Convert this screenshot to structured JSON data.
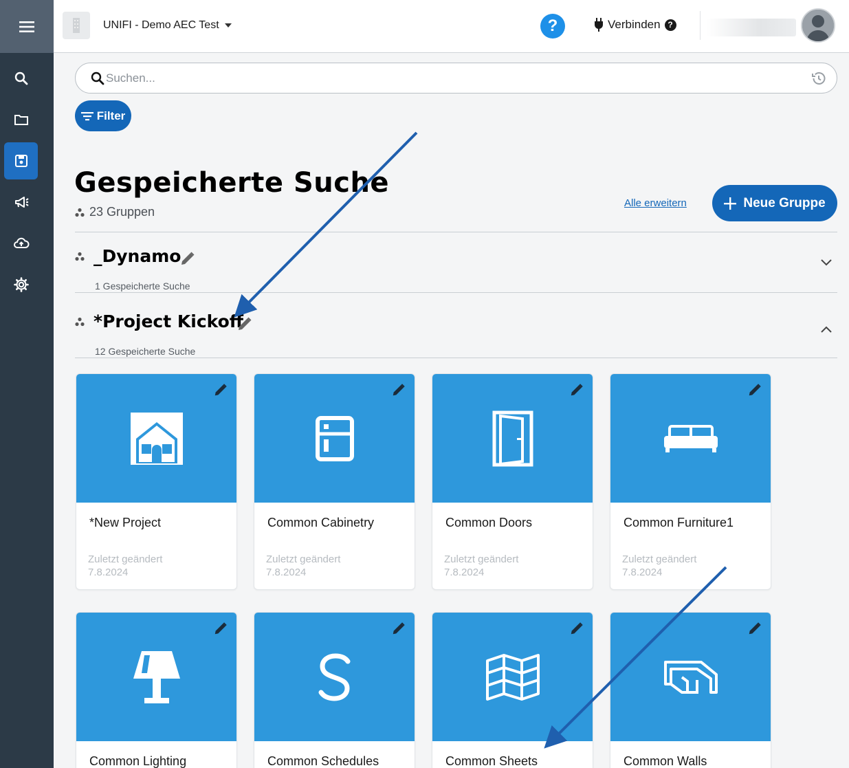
{
  "header": {
    "project_name": "UNIFI - Demo AEC Test",
    "help_label": "?",
    "connect_label": "Verbinden",
    "connect_help": "?"
  },
  "search": {
    "placeholder": "Suchen..."
  },
  "filter": {
    "label": "Filter"
  },
  "page": {
    "title": "Gespeicherte Suche",
    "group_count": "23 Gruppen",
    "expand_all": "Alle erweitern",
    "new_group": "Neue Gruppe"
  },
  "groups": [
    {
      "name": "_Dynamo",
      "count_label": "1 Gespeicherte Suche",
      "expanded": false
    },
    {
      "name": "*Project Kickoff",
      "count_label": "12 Gespeicherte Suche",
      "expanded": true
    }
  ],
  "cards": [
    {
      "title": "*New Project",
      "meta_label": "Zuletzt geändert",
      "meta_date": "7.8.2024",
      "icon": "house-icon"
    },
    {
      "title": "Common Cabinetry",
      "meta_label": "Zuletzt geändert",
      "meta_date": "7.8.2024",
      "icon": "cabinet-icon"
    },
    {
      "title": "Common Doors",
      "meta_label": "Zuletzt geändert",
      "meta_date": "7.8.2024",
      "icon": "door-icon"
    },
    {
      "title": "Common Furniture1",
      "meta_label": "Zuletzt geändert",
      "meta_date": "7.8.2024",
      "icon": "sofa-icon"
    },
    {
      "title": "Common Lighting",
      "icon": "lamp-icon"
    },
    {
      "title": "Common Schedules",
      "icon": "letter-s-icon"
    },
    {
      "title": "Common Sheets",
      "icon": "map-sheets-icon"
    },
    {
      "title": "Common Walls",
      "icon": "walls-icon"
    }
  ],
  "colors": {
    "sidebar": "#2c3a47",
    "accent": "#1467b8",
    "card_image": "#2e98dc",
    "annotation_arrow": "#1f5fae"
  }
}
